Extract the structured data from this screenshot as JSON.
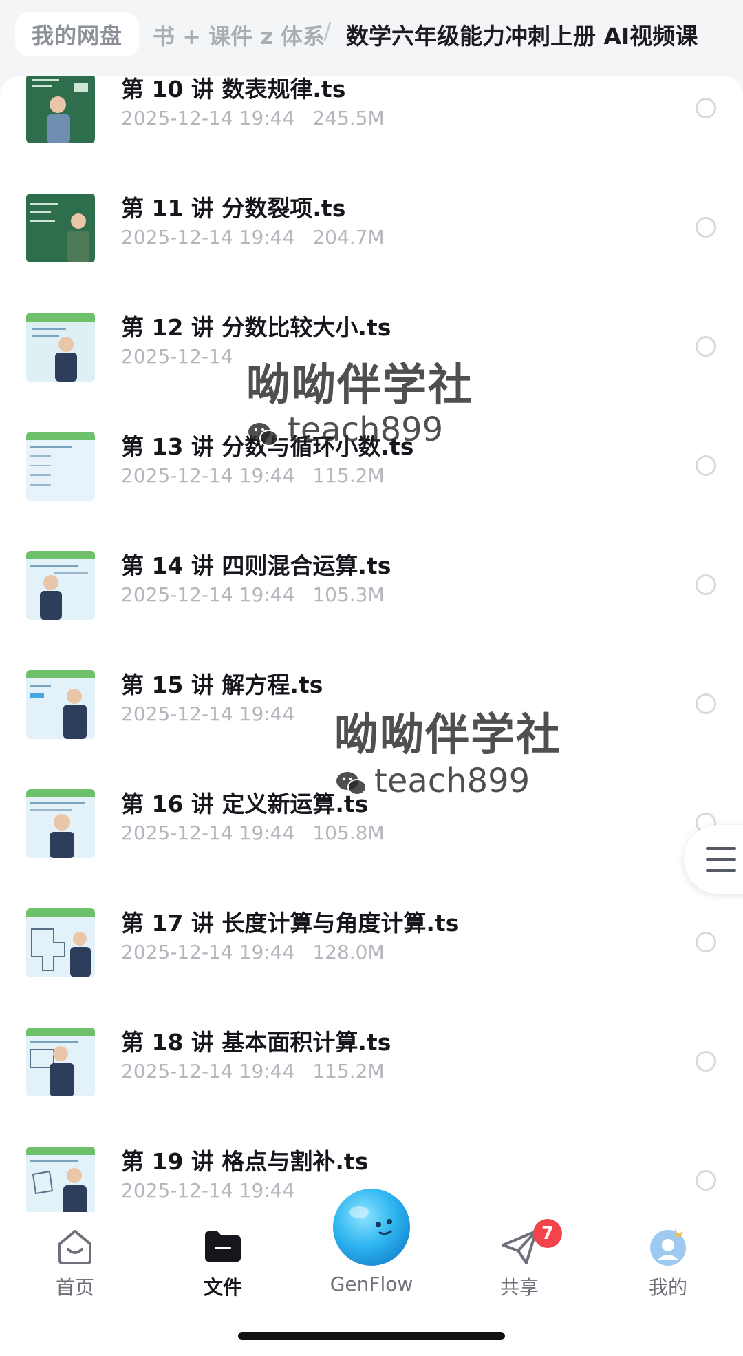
{
  "header": {
    "home_label": "我的网盘",
    "middle_crumb": "书 + 课件 z 体系",
    "separator": "/",
    "current_folder": "数学六年级能力冲刺上册 AI视频课"
  },
  "files": [
    {
      "name": "第 10 讲 数表规律.ts",
      "date": "2025-12-14 19:44",
      "size": "245.5M"
    },
    {
      "name": "第 11 讲 分数裂项.ts",
      "date": "2025-12-14 19:44",
      "size": "204.7M"
    },
    {
      "name": "第 12 讲 分数比较大小.ts",
      "date": "2025-12-14 ",
      "size": ""
    },
    {
      "name": "第 13 讲 分数与循环小数.ts",
      "date": "2025-12-14 19:44",
      "size": "115.2M"
    },
    {
      "name": "第 14 讲 四则混合运算.ts",
      "date": "2025-12-14 19:44",
      "size": "105.3M"
    },
    {
      "name": "第 15 讲 解方程.ts",
      "date": "2025-12-14 19:44",
      "size": ""
    },
    {
      "name": "第 16 讲 定义新运算.ts",
      "date": "2025-12-14 19:44",
      "size": "105.8M"
    },
    {
      "name": "第 17 讲 长度计算与角度计算.ts",
      "date": "2025-12-14 19:44",
      "size": "128.0M"
    },
    {
      "name": "第 18 讲 基本面积计算.ts",
      "date": "2025-12-14 19:44",
      "size": "115.2M"
    },
    {
      "name": "第 19 讲 格点与割补.ts",
      "date": "2025-12-14 19:44",
      "size": ""
    }
  ],
  "watermark": {
    "title": "呦呦伴学社",
    "wechat_id": "teach899"
  },
  "nav": {
    "home": "首页",
    "files": "文件",
    "genflow": "GenFlow",
    "share": "共享",
    "share_badge": "7",
    "mine": "我的"
  },
  "colors": {
    "accent": "#2fb6f0",
    "badge": "#f4434a",
    "folder_active": "#15171c"
  }
}
